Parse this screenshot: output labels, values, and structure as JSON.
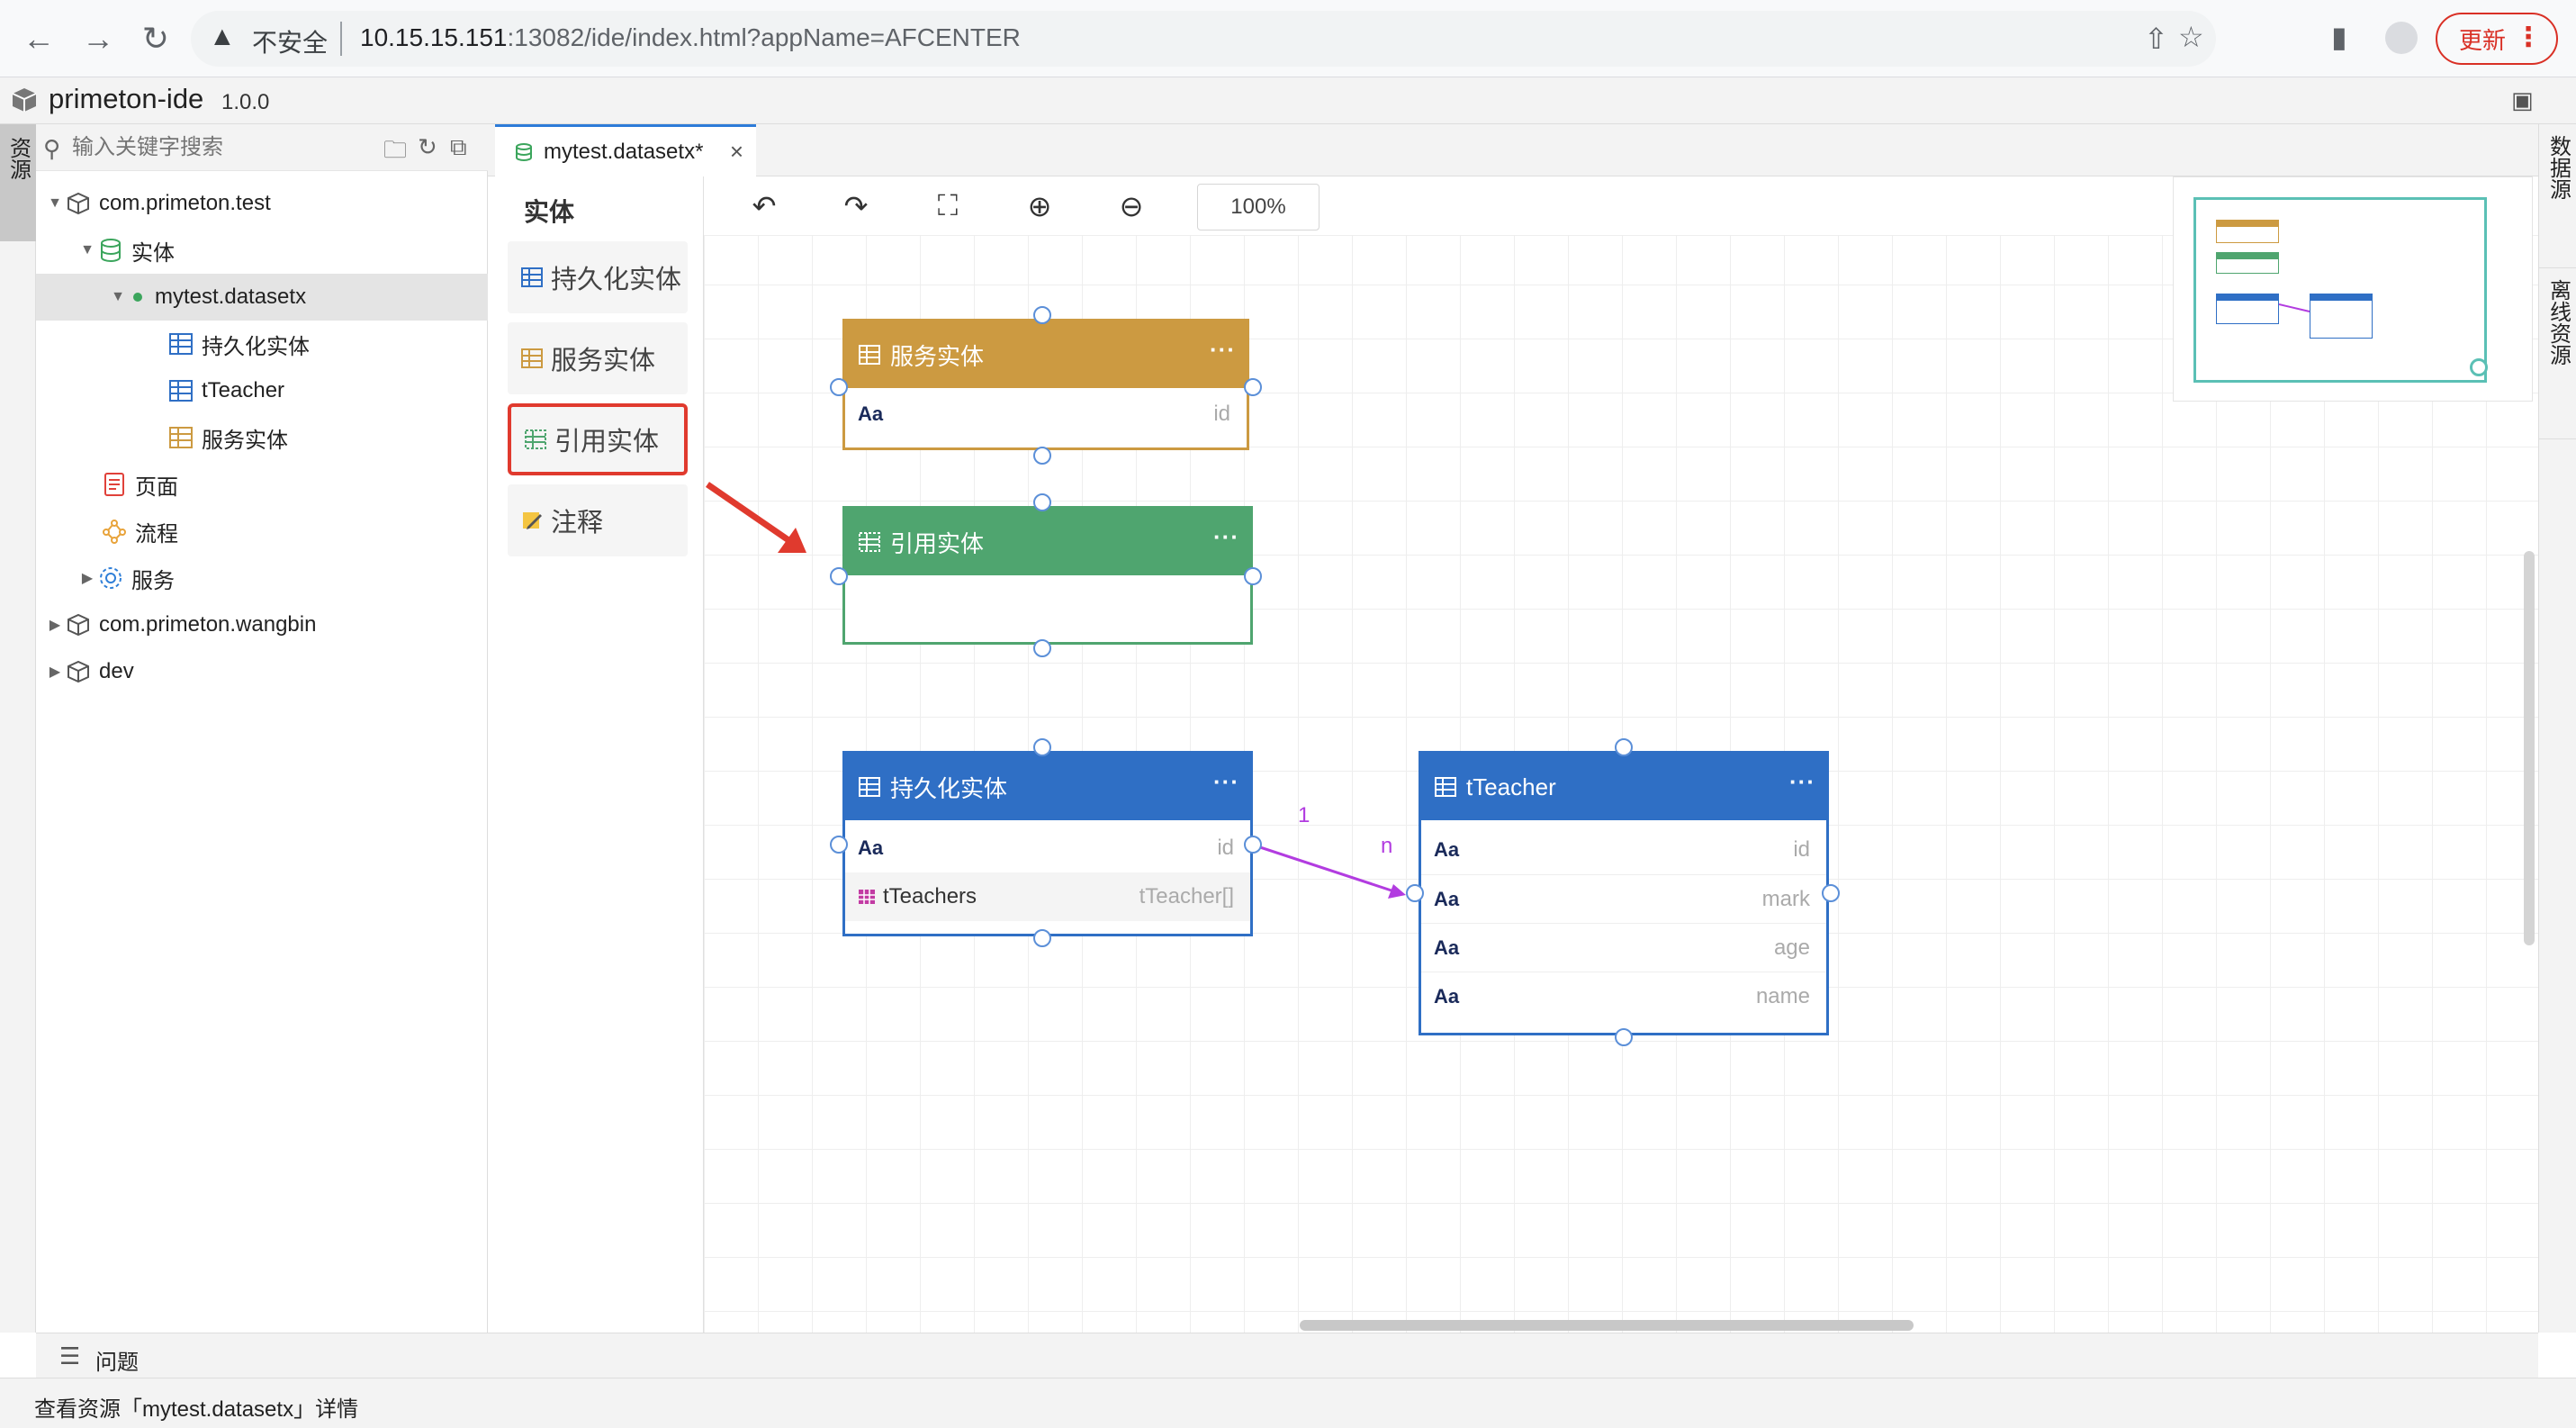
{
  "browser": {
    "security_label": "不安全",
    "url_host": "10.15.15.151",
    "url_rest": ":13082/ide/index.html?appName=AFCENTER",
    "update_label": "更新"
  },
  "app": {
    "title": "primeton-ide",
    "version": "1.0.0"
  },
  "left_tab": {
    "label": "资源"
  },
  "explorer": {
    "search_placeholder": "输入关键字搜索",
    "tree": [
      {
        "label": "com.primeton.test"
      },
      {
        "label": "实体"
      },
      {
        "label": "mytest.datasetx"
      },
      {
        "label": "持久化实体"
      },
      {
        "label": "tTeacher"
      },
      {
        "label": "服务实体"
      },
      {
        "label": "页面"
      },
      {
        "label": "流程"
      },
      {
        "label": "服务"
      },
      {
        "label": "com.primeton.wangbin"
      },
      {
        "label": "dev"
      }
    ]
  },
  "editor": {
    "tab_label": "mytest.datasetx*"
  },
  "palette": {
    "title": "实体",
    "items": [
      {
        "label": "持久化实体"
      },
      {
        "label": "服务实体"
      },
      {
        "label": "引用实体"
      },
      {
        "label": "注释"
      }
    ]
  },
  "canvas": {
    "zoom": "100%",
    "entities": {
      "service": {
        "title": "服务实体",
        "color": "#cc9a41",
        "fields": [
          {
            "type_icon": "Aa",
            "name": "",
            "type": "id"
          }
        ]
      },
      "reference": {
        "title": "引用实体",
        "color": "#4fa56f",
        "fields": []
      },
      "persistent": {
        "title": "持久化实体",
        "color": "#2f6fc5",
        "fields": [
          {
            "type_icon": "Aa",
            "name": "",
            "type": "id"
          },
          {
            "type_icon": "table",
            "name": "tTeachers",
            "type": "tTeacher[]"
          }
        ]
      },
      "tteacher": {
        "title": "tTeacher",
        "color": "#2f6fc5",
        "fields": [
          {
            "type_icon": "Aa",
            "name": "",
            "type": "id"
          },
          {
            "type_icon": "Aa",
            "name": "",
            "type": "mark"
          },
          {
            "type_icon": "Aa",
            "name": "",
            "type": "age"
          },
          {
            "type_icon": "Aa",
            "name": "",
            "type": "name"
          }
        ]
      }
    },
    "relation": {
      "source_label": "1",
      "target_label": "n",
      "color": "#b23ce0"
    },
    "more_glyph": "···"
  },
  "right_tabs": [
    {
      "label": "数据源"
    },
    {
      "label": "离线资源"
    }
  ],
  "bottom": {
    "problems_label": "问题",
    "status_text": "查看资源「mytest.datasetx」详情"
  }
}
